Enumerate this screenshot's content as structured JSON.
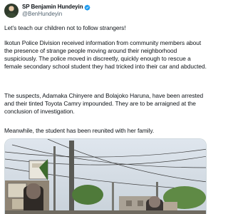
{
  "author": {
    "display_name": "SP Benjamin Hundeyin",
    "handle": "@BenHundeyin",
    "verified": true,
    "verified_color": "#1d9bf0"
  },
  "tweet": {
    "paragraphs": [
      "Let’s teach our children not to follow strangers!",
      "Ikotun Police Division received information from community members about the presence of strange people moving around their neighborhood suspiciously. The police moved in discreetly, quickly enough to rescue a female secondary school student they had tricked into their car and abducted.",
      "The suspects, Adamaka Chinyere and Bolajoko Haruna, have been arrested and their tinted Toyota Camry impounded. They are to be arraigned at the conclusion of investigation.",
      "Meanwhile, the student has been reunited with her family."
    ]
  },
  "media": {
    "type": "photo"
  },
  "icons": {
    "verified": "verified-badge-icon"
  }
}
